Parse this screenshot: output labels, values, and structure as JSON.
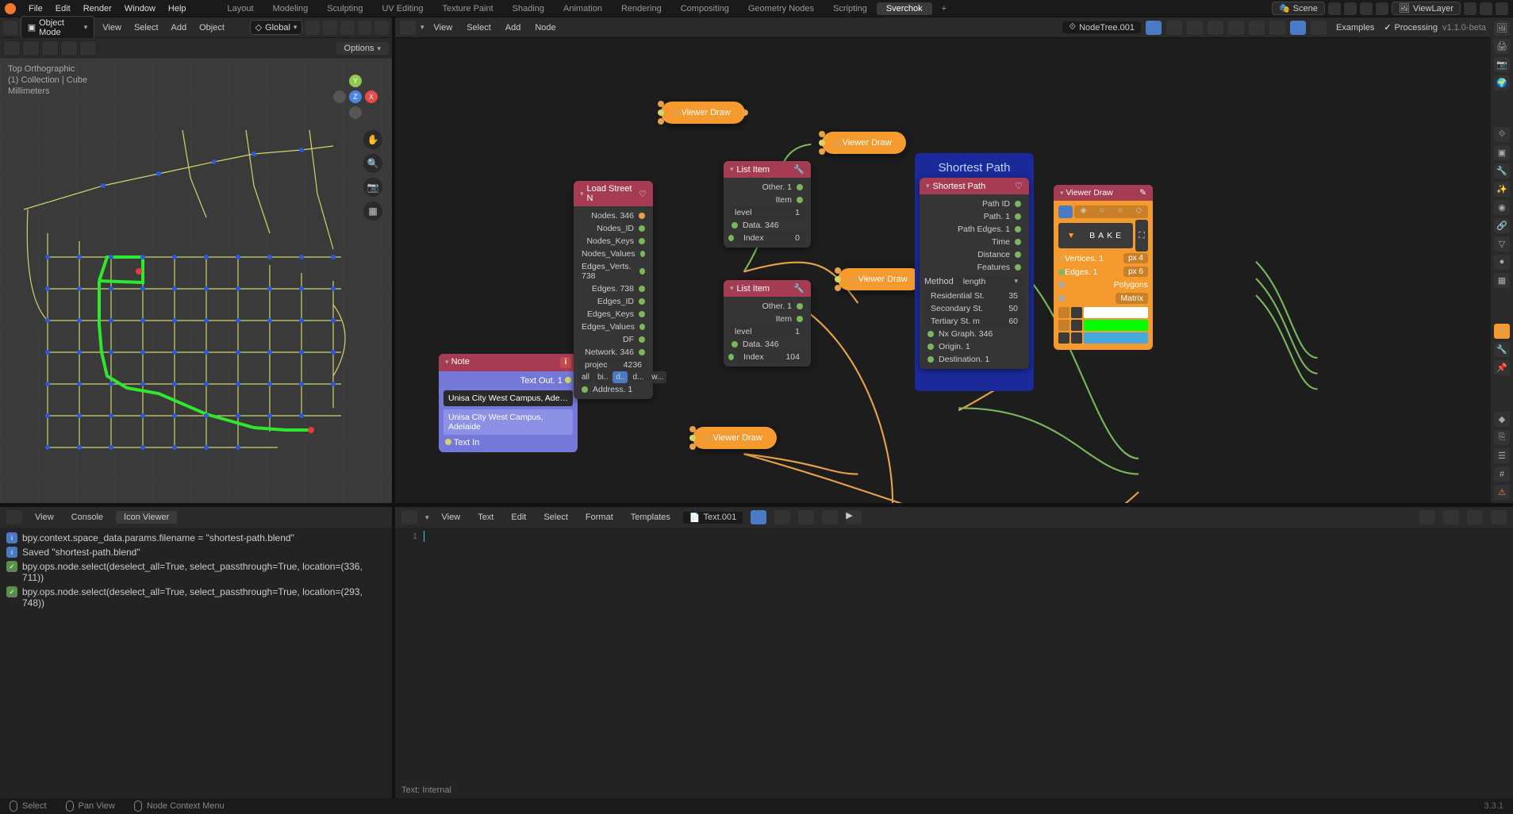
{
  "top_menu": {
    "items": [
      "File",
      "Edit",
      "Render",
      "Window",
      "Help"
    ]
  },
  "workspaces": {
    "tabs": [
      "Layout",
      "Modeling",
      "Sculpting",
      "UV Editing",
      "Texture Paint",
      "Shading",
      "Animation",
      "Rendering",
      "Compositing",
      "Geometry Nodes",
      "Scripting",
      "Sverchok"
    ],
    "active": "Sverchok"
  },
  "scene": {
    "label": "Scene",
    "viewlayer": "ViewLayer"
  },
  "viewport": {
    "mode": "Object Mode",
    "menus": [
      "View",
      "Select",
      "Add",
      "Object"
    ],
    "orientation": "Global",
    "options_label": "Options",
    "overlay": {
      "line1": "Top Orthographic",
      "line2": "(1) Collection | Cube",
      "line3": "Millimeters"
    },
    "gizmo": {
      "y": "Y",
      "x": "X",
      "z": "Z"
    }
  },
  "node_editor": {
    "menus": [
      "View",
      "Select",
      "Add",
      "Node"
    ],
    "tree_name": "NodeTree.001",
    "right_group": {
      "examples": "Examples",
      "processing_chk": "Processing",
      "version": "v1.1.0-beta"
    }
  },
  "nodes": {
    "viewer_draw_tl": "Viewer Draw",
    "viewer_draw_tr": "Viewer Draw",
    "viewer_draw_mid": "Viewer Draw",
    "viewer_draw_bot": "Viewer Draw",
    "note": {
      "title": "Note",
      "text_out": "Text Out. 1",
      "field": "Unisa City West Campus, Adelai...",
      "display": "Unisa City West Campus, Adelaide",
      "text_in": "Text In"
    },
    "load_street": {
      "title": "Load Street N",
      "rows": [
        {
          "label": "Nodes. 346"
        },
        {
          "label": "Nodes_ID"
        },
        {
          "label": "Nodes_Keys"
        },
        {
          "label": "Nodes_Values"
        },
        {
          "label": "Edges_Verts. 738"
        },
        {
          "label": "Edges. 738"
        },
        {
          "label": "Edges_ID"
        },
        {
          "label": "Edges_Keys"
        },
        {
          "label": "Edges_Values"
        },
        {
          "label": "DF"
        },
        {
          "label": "Network. 346"
        }
      ],
      "projec": {
        "label": "projec",
        "val": "4236"
      },
      "btns": [
        "all",
        "bi..",
        "d..",
        "d...",
        "w..."
      ],
      "address": "Address. 1"
    },
    "list_item_1": {
      "title": "List Item",
      "other": "Other. 1",
      "item": "Item",
      "level": {
        "label": "level",
        "val": "1"
      },
      "data": "Data. 346",
      "index": {
        "label": "Index",
        "val": "0"
      }
    },
    "list_item_2": {
      "title": "List Item",
      "other": "Other. 1",
      "item": "Item",
      "level": {
        "label": "level",
        "val": "1"
      },
      "data": "Data. 346",
      "index": {
        "label": "Index",
        "val": "104"
      }
    },
    "shortest_path_frame": "Shortest Path",
    "shortest_path": {
      "title": "Shortest Path",
      "out_rows": [
        "Path ID",
        "Path. 1",
        "Path Edges. 1",
        "Time",
        "Distance",
        "Features"
      ],
      "method": {
        "label": "Method",
        "val": "length"
      },
      "residential": {
        "label": "Residential St.",
        "val": "35"
      },
      "secondary": {
        "label": "Secondary St.",
        "val": "50"
      },
      "tertiary": {
        "label": "Tertiary St. m",
        "val": "60"
      },
      "in_rows": [
        "Nx Graph. 346",
        "Origin. 1",
        "Destination. 1"
      ]
    },
    "vdraw": {
      "title": "Viewer Draw",
      "bake": "BAKE",
      "vertices": {
        "label": "Vertices. 1",
        "val": "px  4"
      },
      "edges": {
        "label": "Edges. 1",
        "val": "px  6"
      },
      "polygons": "Polygons",
      "matrix": "Matrix"
    }
  },
  "console": {
    "menus": [
      "View",
      "Console"
    ],
    "tab": "Icon Viewer",
    "lines": [
      {
        "icon": "i",
        "text": "bpy.context.space_data.params.filename = \"shortest-path.blend\""
      },
      {
        "icon": "i",
        "text": "Saved \"shortest-path.blend\""
      },
      {
        "icon": "chk",
        "text": "bpy.ops.node.select(deselect_all=True, select_passthrough=True, location=(336, 711))"
      },
      {
        "icon": "chk",
        "text": "bpy.ops.node.select(deselect_all=True, select_passthrough=True, location=(293, 748))"
      }
    ]
  },
  "text_editor": {
    "menus": [
      "View",
      "Text",
      "Edit",
      "Select",
      "Format",
      "Templates"
    ],
    "name": "Text.001",
    "line_no": "1",
    "status": "Text: Internal"
  },
  "statusbar": {
    "select": "Select",
    "pan": "Pan View",
    "context": "Node Context Menu",
    "version": "3.3.1"
  }
}
